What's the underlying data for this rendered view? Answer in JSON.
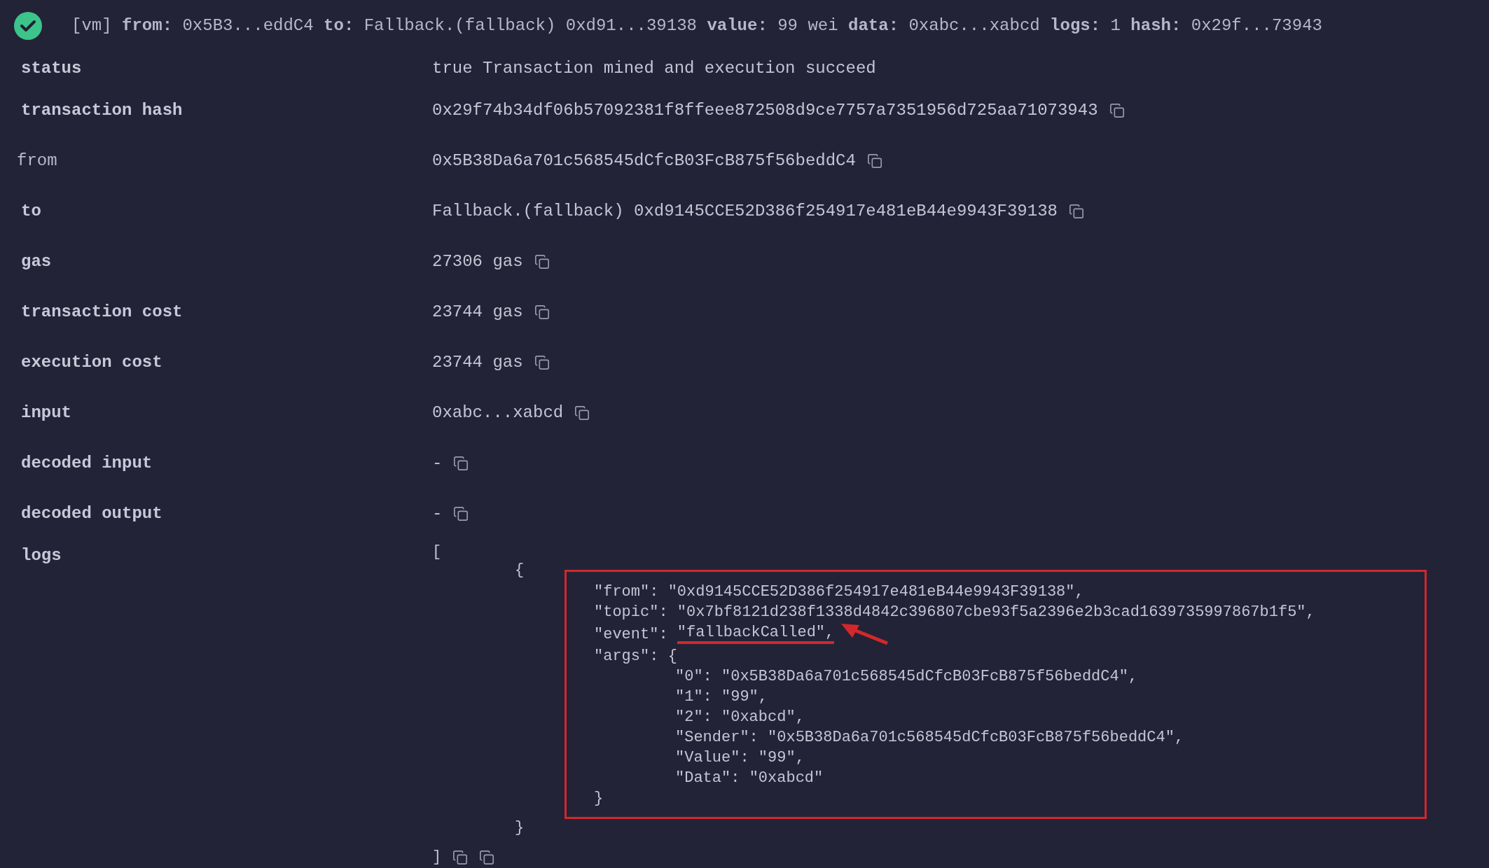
{
  "header": {
    "success": true,
    "summary": "[vm] **from:** 0x5B3...eddC4 **to:** Fallback.(fallback) 0xd91...39138 **value:** 99 wei **data:** 0xabc...xabcd **logs:** 1 **hash:** 0x29f...73943"
  },
  "rows": [
    {
      "label": "status",
      "bold": true,
      "value": "true Transaction mined and execution succeed",
      "copy": false
    },
    {
      "label": "transaction hash",
      "bold": true,
      "value": "0x29f74b34df06b57092381f8ffeee872508d9ce7757a7351956d725aa71073943",
      "copy": true
    },
    {
      "label": "from",
      "bold": false,
      "value": "0x5B38Da6a701c568545dCfcB03FcB875f56beddC4",
      "copy": true
    },
    {
      "label": "to",
      "bold": true,
      "value": "Fallback.(fallback) 0xd9145CCE52D386f254917e481eB44e9943F39138",
      "copy": true
    },
    {
      "label": "gas",
      "bold": true,
      "value": "27306 gas",
      "copy": true
    },
    {
      "label": "transaction cost",
      "bold": true,
      "value": "23744 gas",
      "copy": true
    },
    {
      "label": "execution cost",
      "bold": true,
      "value": "23744 gas",
      "copy": true
    },
    {
      "label": "input",
      "bold": true,
      "value": "0xabc...xabcd",
      "copy": true
    },
    {
      "label": "decoded input",
      "bold": true,
      "value": "-",
      "copy": true
    },
    {
      "label": "decoded output",
      "bold": true,
      "value": "-",
      "copy": true
    }
  ],
  "logs": {
    "label": "logs",
    "open": "[",
    "entry_open": "{",
    "lines": [
      {
        "key": "\"from\":",
        "value": "\"0xd9145CCE52D386f254917e481eB44e9943F39138\",",
        "highlighted": false
      },
      {
        "key": "\"topic\":",
        "value": "\"0x7bf8121d238f1338d4842c396807cbe93f5a2396e2b3cad1639735997867b1f5\",",
        "highlighted": false
      },
      {
        "key": "\"event\":",
        "value": "\"fallbackCalled\",",
        "highlighted": true
      },
      {
        "key": "\"args\":",
        "value": "{",
        "highlighted": false
      }
    ],
    "args": [
      {
        "key": "\"0\":",
        "value": "\"0x5B38Da6a701c568545dCfcB03FcB875f56beddC4\","
      },
      {
        "key": "\"1\":",
        "value": "\"99\","
      },
      {
        "key": "\"2\":",
        "value": "\"0xabcd\","
      },
      {
        "key": "\"Sender\":",
        "value": "\"0x5B38Da6a701c568545dCfcB03FcB875f56beddC4\","
      },
      {
        "key": "\"Value\":",
        "value": "\"99\","
      },
      {
        "key": "\"Data\":",
        "value": "\"0xabcd\""
      }
    ],
    "args_close": "}",
    "entry_close": "}",
    "close": "]"
  }
}
